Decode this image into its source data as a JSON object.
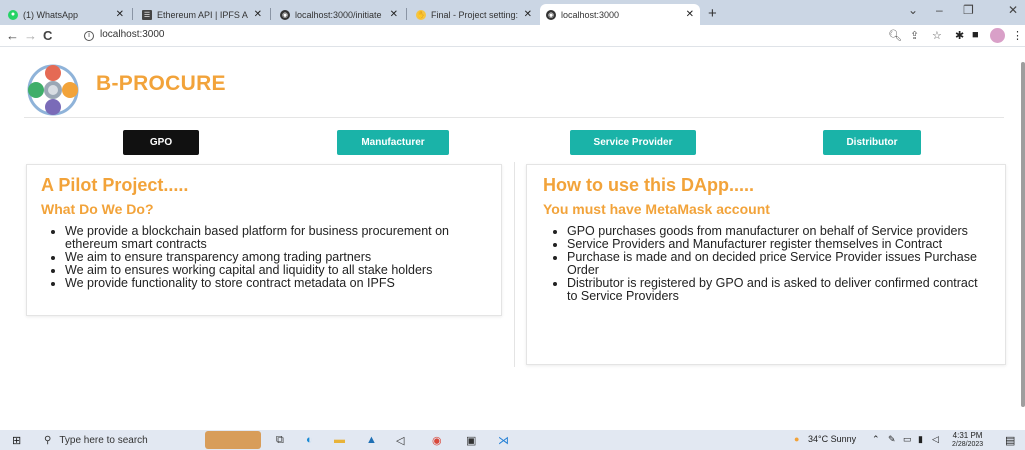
{
  "browser": {
    "tabs": [
      {
        "title": "(1) WhatsApp",
        "favicon": "whatsapp-icon",
        "color": "#25d366"
      },
      {
        "title": "Ethereum API | IPFS A",
        "favicon": "grid-icon",
        "color": "#444444"
      },
      {
        "title": "localhost:3000/initiate",
        "favicon": "globe-icon",
        "color": "#333333"
      },
      {
        "title": "Final - Project setting:",
        "favicon": "hand-icon",
        "color": "#f5c542"
      },
      {
        "title": "localhost:3000",
        "favicon": "globe-icon",
        "color": "#333333",
        "active": true
      }
    ],
    "new_tab": "+",
    "url": "localhost:3000",
    "window_controls": {
      "chevron": "⌄",
      "minimize": "–",
      "restore": "❐",
      "close": "✕"
    },
    "toolbar_icons": [
      "search-zoom-icon",
      "share-icon",
      "star-icon",
      "extensions-icon",
      "sidebar-icon",
      "profile-avatar"
    ]
  },
  "app": {
    "brand": "B-PROCURE",
    "accent": "#f2a33a",
    "roles": [
      {
        "label": "GPO",
        "color": "#111111"
      },
      {
        "label": "Manufacturer",
        "color": "#1ab3a8"
      },
      {
        "label": "Service Provider",
        "color": "#1ab3a8"
      },
      {
        "label": "Distributor",
        "color": "#1ab3a8"
      }
    ],
    "left_card": {
      "title": "A Pilot Project.....",
      "subtitle": "What Do We Do?",
      "items": [
        "We provide a blockchain based platform for business procurement on ethereum smart contracts",
        "We aim to ensure transparency among trading partners",
        "We aim to ensures working capital and liquidity to all stake holders",
        "We provide functionality to store contract metadata on IPFS"
      ]
    },
    "right_card": {
      "title": "How to use this DApp.....",
      "subtitle": "You must have MetaMask account",
      "items": [
        "GPO purchases goods from manufacturer on behalf of Service providers",
        "Service Providers and Manufacturer register themselves in Contract",
        "Purchase is made and on decided price Service Provider issues Purchase Order",
        "Distributor is registered by GPO and is asked to deliver confirmed contract to Service Providers"
      ]
    }
  },
  "taskbar": {
    "search_placeholder": "Type here to search",
    "weather": "34°C  Sunny",
    "time": "4:31 PM",
    "date": "2/28/2023"
  }
}
